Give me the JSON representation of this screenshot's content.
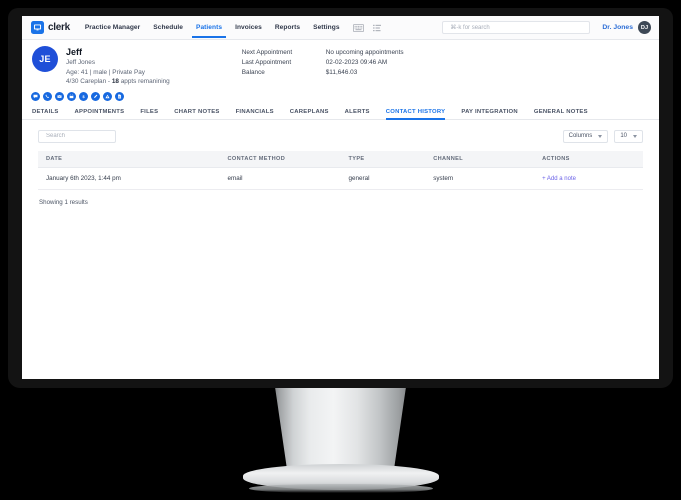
{
  "topnav": {
    "brand": "clerk",
    "brand_icon": "monitor-icon",
    "links": [
      {
        "label": "Practice Manager",
        "active": false
      },
      {
        "label": "Schedule",
        "active": false
      },
      {
        "label": "Patients",
        "active": true
      },
      {
        "label": "Invoices",
        "active": false
      },
      {
        "label": "Reports",
        "active": false
      },
      {
        "label": "Settings",
        "active": false
      }
    ],
    "icons": [
      "keyboard-icon",
      "list-icon"
    ],
    "search": {
      "placeholder": "⌘-k for search",
      "value": ""
    },
    "user": {
      "name": "Dr. Jones",
      "initials": "DJ"
    }
  },
  "patient": {
    "initials": "JE",
    "display_name": "Jeff",
    "full_name": "Jeff Jones",
    "demographics": "Age: 41 | male | Private Pay",
    "careplan_prefix": "4/30 Careplan - ",
    "careplan_count": "18",
    "careplan_suffix": " appts remanining",
    "appointments": [
      {
        "label": "Next Appointment",
        "value": "No upcoming appointments"
      },
      {
        "label": "Last Appointment",
        "value": "02-02-2023 09:46 AM"
      },
      {
        "label": "Balance",
        "value": "$11,646.03"
      }
    ],
    "quick_actions": [
      "message-icon",
      "phone-icon",
      "email-icon",
      "calendar-icon",
      "dollar-icon",
      "edit-icon",
      "alert-icon",
      "document-icon"
    ]
  },
  "tabs": [
    {
      "label": "DETAILS",
      "active": false
    },
    {
      "label": "APPOINTMENTS",
      "active": false
    },
    {
      "label": "FILES",
      "active": false
    },
    {
      "label": "CHART NOTES",
      "active": false
    },
    {
      "label": "FINANCIALS",
      "active": false
    },
    {
      "label": "CAREPLANS",
      "active": false
    },
    {
      "label": "ALERTS",
      "active": false
    },
    {
      "label": "CONTACT HISTORY",
      "active": true
    },
    {
      "label": "PAY INTEGRATION",
      "active": false
    },
    {
      "label": "GENERAL NOTES",
      "active": false
    }
  ],
  "toolbar": {
    "search_placeholder": "Search",
    "search_value": "",
    "columns_label": "Columns",
    "page_size": "10"
  },
  "table": {
    "headers": [
      "DATE",
      "CONTACT METHOD",
      "TYPE",
      "CHANNEL",
      "ACTIONS"
    ],
    "rows": [
      {
        "date": "January 6th 2023, 1:44 pm",
        "contact_method": "email",
        "type": "general",
        "channel": "system",
        "action": "+ Add a note"
      }
    ],
    "results_text": "Showing 1 results"
  },
  "colors": {
    "accent": "#1a73e8",
    "avatar": "#1f4fd8",
    "link": "#6c63e8",
    "header_bg": "#f4f5f7"
  }
}
